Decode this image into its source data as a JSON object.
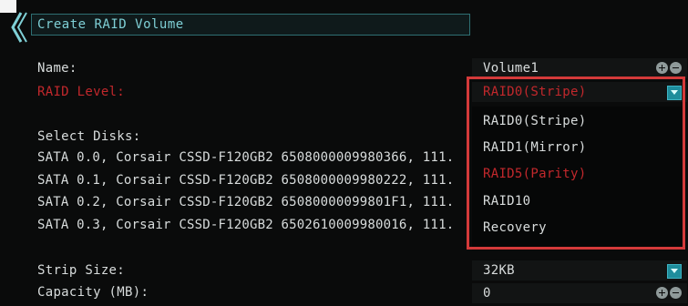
{
  "header": {
    "title": "Create RAID Volume"
  },
  "form": {
    "name_label": "Name:",
    "name_value": "Volume1",
    "raid_level_label": "RAID Level:",
    "raid_level_value": "RAID0(Stripe)",
    "select_disks_label": "Select Disks:",
    "disks": [
      "SATA 0.0, Corsair CSSD-F120GB2 6508000009980366, 111.",
      "SATA 0.1, Corsair CSSD-F120GB2 6508000009980222, 111.",
      "SATA 0.2, Corsair CSSD-F120GB2 65080000099801F1, 111.",
      "SATA 0.3, Corsair CSSD-F120GB2 6502610009980016, 111."
    ],
    "strip_size_label": "Strip Size:",
    "strip_size_value": "32KB",
    "capacity_label": "Capacity (MB):",
    "capacity_value": "0"
  },
  "raid_options": [
    {
      "label": "RAID0(Stripe)",
      "selected": false
    },
    {
      "label": "RAID1(Mirror)",
      "selected": false
    },
    {
      "label": "RAID5(Parity)",
      "selected": true
    },
    {
      "label": "RAID10",
      "selected": false
    },
    {
      "label": "Recovery",
      "selected": false
    }
  ],
  "colors": {
    "accent": "#1e8d9c",
    "selected_text": "#c2282c",
    "highlight_border": "#d43a3a"
  }
}
